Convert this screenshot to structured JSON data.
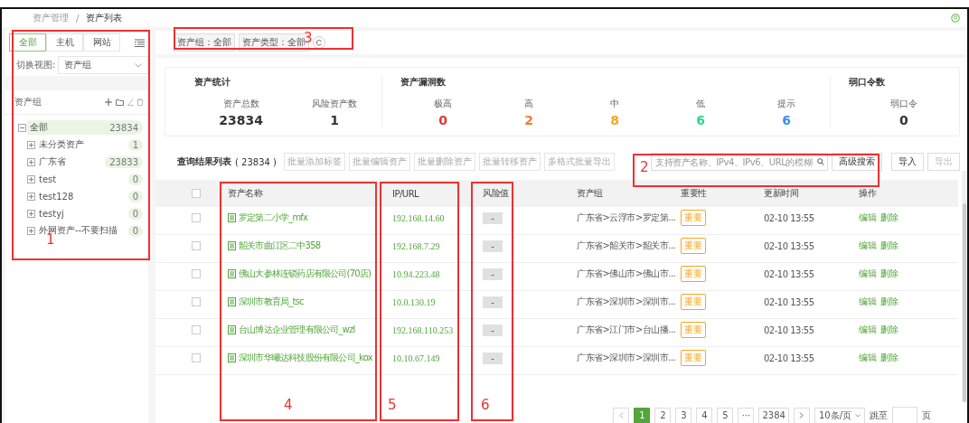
{
  "breadcrumb": [
    "资产管理",
    "/",
    "资产列表"
  ],
  "sidebar": {
    "tabs": [
      {
        "label": "全部",
        "selected": true
      },
      {
        "label": "主机",
        "selected": false
      },
      {
        "label": "网站",
        "selected": false
      }
    ],
    "view_label": "切换视图:",
    "view_value": "资产组",
    "group_title": "资产组",
    "tree": [
      {
        "label": "全部",
        "count": "23834",
        "expanded": true,
        "selected": true,
        "children": [
          {
            "label": "未分类资产",
            "count": "1",
            "expanded": false,
            "selected": false
          },
          {
            "label": "广东省",
            "count": "23833",
            "expanded": false,
            "selected": false
          },
          {
            "label": "test",
            "count": "0",
            "expanded": false,
            "selected": false
          },
          {
            "label": "test128",
            "count": "0",
            "expanded": false,
            "selected": false
          },
          {
            "label": "testyj",
            "count": "0",
            "expanded": false,
            "selected": false
          },
          {
            "label": "外网资产--不要扫描",
            "count": "0",
            "expanded": false,
            "selected": false
          }
        ]
      }
    ]
  },
  "filters": [
    "资产组：全部",
    "资产类型：全部"
  ],
  "stats": [
    {
      "title": "资产统计",
      "items": [
        {
          "label": "资产总数",
          "value": "23834",
          "color": "#333333"
        },
        {
          "label": "风险资产数",
          "value": "1",
          "color": "#333333"
        }
      ]
    },
    {
      "title": "资产漏洞数",
      "items": [
        {
          "label": "极高",
          "value": "0",
          "color": "#e8362b"
        },
        {
          "label": "高",
          "value": "2",
          "color": "#f07c2e"
        },
        {
          "label": "中",
          "value": "8",
          "color": "#f5a623"
        },
        {
          "label": "低",
          "value": "6",
          "color": "#2fd58a"
        },
        {
          "label": "提示",
          "value": "6",
          "color": "#3a8ff0"
        }
      ]
    },
    {
      "title": "弱口令数",
      "items": [
        {
          "label": "弱口令",
          "value": "0",
          "color": "#333333"
        }
      ]
    }
  ],
  "list_title": "查询结果列表",
  "list_count": "( 23834 )",
  "batch_buttons": [
    "批量添加标签",
    "批量编辑资产",
    "批量删除资产",
    "批量转移资产",
    "多格式批量导出"
  ],
  "search": {
    "placeholder": "支持资产名称、IPv4、IPv6、URL的模糊"
  },
  "advanced_search": "高级搜索",
  "import": "导入",
  "export": "导出",
  "table": {
    "header_checked": false,
    "columns": [
      "资产名称",
      "IP/URL",
      "风险值",
      "资产组",
      "重要性",
      "更新时间",
      "操作"
    ],
    "rows": [
      {
        "name": "罗定第二小学_mfx",
        "ip": "192.168.14.60",
        "risk": "-",
        "group": "广东省>云浮市>罗定第...",
        "importance": "重要",
        "time": "02-10 13:55",
        "actions": [
          "编辑",
          "删除"
        ],
        "checked": false
      },
      {
        "name": "韶关市曲江区二中358",
        "ip": "192.168.7.29",
        "risk": "-",
        "group": "广东省>韶关市>韶关市...",
        "importance": "重要",
        "time": "02-10 13:55",
        "actions": [
          "编辑",
          "删除"
        ],
        "checked": false
      },
      {
        "name": "佛山大参林连锁药店有限公司(70店)",
        "ip": "10.94.223.48",
        "risk": "-",
        "group": "广东省>佛山市>佛山市...",
        "importance": "重要",
        "time": "02-10 13:55",
        "actions": [
          "编辑",
          "删除"
        ],
        "checked": false
      },
      {
        "name": "深圳市教育局_tsc",
        "ip": "10.0.130.19",
        "risk": "-",
        "group": "广东省>深圳市>深圳市...",
        "importance": "重要",
        "time": "02-10 13:55",
        "actions": [
          "编辑",
          "删除"
        ],
        "checked": false
      },
      {
        "name": "台山博达企业管理有限公司_wzl",
        "ip": "192.168.110.253",
        "risk": "-",
        "group": "广东省>江门市>台山播...",
        "importance": "重要",
        "time": "02-10 13:55",
        "actions": [
          "编辑",
          "删除"
        ],
        "checked": false
      },
      {
        "name": "深圳市华曦达科技股份有限公司_kox",
        "ip": "10.10.67.149",
        "risk": "-",
        "group": "广东省>深圳市>深圳市...",
        "importance": "重要",
        "time": "02-10 13:55",
        "actions": [
          "编辑",
          "删除"
        ],
        "checked": false
      }
    ]
  },
  "pagination": {
    "pages": [
      {
        "label": "1",
        "selected": true
      },
      {
        "label": "2",
        "selected": false
      },
      {
        "label": "3",
        "selected": false
      },
      {
        "label": "4",
        "selected": false
      },
      {
        "label": "5",
        "selected": false
      },
      {
        "label": "···",
        "selected": false
      },
      {
        "label": "2384",
        "selected": false
      }
    ],
    "page_size": "10条/页",
    "jump_label": "跳至",
    "page_unit": "页"
  },
  "annotations": [
    "1",
    "2",
    "3",
    "4",
    "5",
    "6"
  ]
}
